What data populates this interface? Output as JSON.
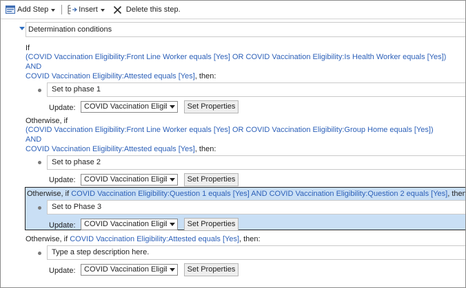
{
  "toolbar": {
    "add_step_label": "Add Step",
    "insert_label": "Insert",
    "delete_label": "Delete this step."
  },
  "section": {
    "title": "Determination conditions"
  },
  "steps": [
    {
      "condition_prefix": "If",
      "condition_lines": [
        "(COVID Vaccination Eligibility:Front Line Worker equals [Yes] OR COVID Vaccination Eligibility:Is Health Worker equals [Yes])",
        "AND",
        "COVID Vaccination Eligibility:Attested equals [Yes]"
      ],
      "condition_suffix": ", then:",
      "description": "Set to phase 1",
      "update_label": "Update:",
      "entity": "COVID Vaccination Eligibility",
      "button": "Set Properties"
    },
    {
      "condition_prefix": "Otherwise, if",
      "condition_lines": [
        "(COVID Vaccination Eligibility:Front Line Worker equals [Yes] OR COVID Vaccination Eligibility:Group Home equals [Yes])",
        "AND",
        "COVID Vaccination Eligibility:Attested equals [Yes]"
      ],
      "condition_suffix": ", then:",
      "description": "Set to phase 2",
      "update_label": "Update:",
      "entity": "COVID Vaccination Eligibility",
      "button": "Set Properties"
    },
    {
      "condition_prefix": "Otherwise, if",
      "condition_lines": [
        "COVID Vaccination Eligibility:Question 1 equals [Yes] AND COVID Vaccination Eligibility:Question 2 equals [Yes]"
      ],
      "condition_suffix": ", then:",
      "description": "Set to Phase 3",
      "update_label": "Update:",
      "entity": "COVID Vaccination Eligibility",
      "button": "Set Properties",
      "selected": true
    },
    {
      "condition_prefix": "Otherwise, if",
      "condition_lines": [
        "COVID Vaccination Eligibility:Attested equals [Yes]"
      ],
      "condition_suffix": ", then:",
      "description_placeholder": "Type a step description here.",
      "update_label": "Update:",
      "entity": "COVID Vaccination Eligibility",
      "button": "Set Properties"
    }
  ],
  "colors": {
    "link_blue": "#2b5fb8",
    "selection": "#c9dff5"
  }
}
